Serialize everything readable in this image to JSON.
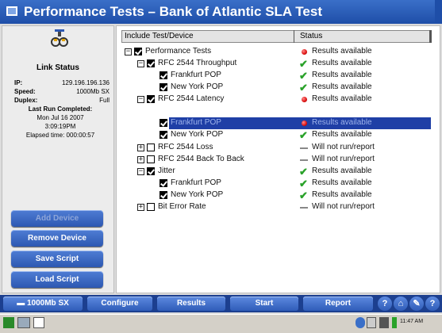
{
  "window": {
    "title": "Performance Tests – Bank of Atlantic SLA Test"
  },
  "left": {
    "title": "Link Status",
    "ip_label": "IP:",
    "ip_value": "129.196.196.136",
    "speed_label": "Speed:",
    "speed_value": "1000Mb SX",
    "duplex_label": "Duplex:",
    "duplex_value": "Full",
    "last_run_label": "Last Run Completed:",
    "last_run_date": "Mon Jul 16 2007",
    "last_run_time": "3:09:19PM",
    "elapsed": "Elapsed time: 000:00:57",
    "buttons": [
      "Add Device",
      "Remove Device",
      "Save Script",
      "Load Script"
    ]
  },
  "table": {
    "col1": "Include Test/Device",
    "col2": "Status",
    "rows": [
      {
        "name": "Performance Tests",
        "status": "Results available",
        "icon": "red-dot-icon"
      },
      {
        "name": "RFC 2544 Throughput",
        "status": "Results available",
        "icon": "check-icon"
      },
      {
        "name": "Frankfurt POP",
        "status": "Results available",
        "icon": "check-icon"
      },
      {
        "name": "New York POP",
        "status": "Results available",
        "icon": "check-icon"
      },
      {
        "name": "RFC 2544 Latency",
        "status": "Results available",
        "icon": "red-dot-icon"
      },
      {
        "name": "Frankfurt POP",
        "status": "Results available",
        "icon": "red-dot-icon"
      },
      {
        "name": "New York POP",
        "status": "Results available",
        "icon": "check-icon"
      },
      {
        "name": "RFC 2544 Loss",
        "status": "Will not run/report",
        "icon": "dash-icon"
      },
      {
        "name": "RFC 2544 Back To Back",
        "status": "Will not run/report",
        "icon": "dash-icon"
      },
      {
        "name": "Jitter",
        "status": "Results available",
        "icon": "check-icon"
      },
      {
        "name": "Frankfurt POP",
        "status": "Results available",
        "icon": "check-icon"
      },
      {
        "name": "New York POP",
        "status": "Results available",
        "icon": "check-icon"
      },
      {
        "name": "Bit Error Rate",
        "status": "Will not run/report",
        "icon": "dash-icon"
      }
    ]
  },
  "toolbar": {
    "port": "1000Mb SX",
    "configure": "Configure",
    "results": "Results",
    "start": "Start",
    "report": "Report",
    "help": "?",
    "home": "⌂",
    "wrench": "✎",
    "extra": "?"
  },
  "taskbar": {
    "clock": "11:47 AM"
  },
  "colors": {
    "accent": "#2d58b2",
    "title_bar": "#1e4ea8",
    "selection": "#1f3fa6"
  }
}
